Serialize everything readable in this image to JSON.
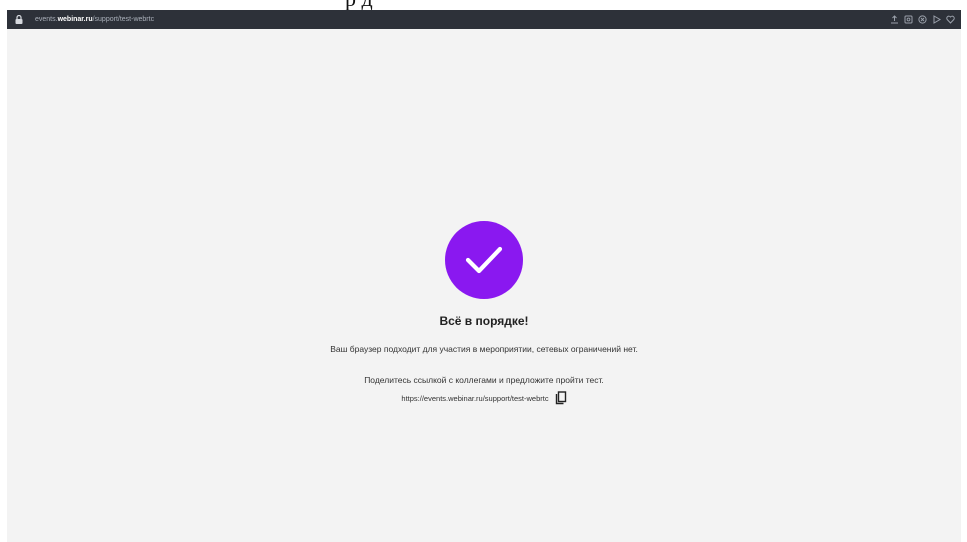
{
  "top_crop": {
    "text": "р д"
  },
  "address_bar": {
    "url_prefix": "events.",
    "url_host": "webinar.ru",
    "url_path": "/support/test-webrtc",
    "icons": [
      "share-icon",
      "screenshot-icon",
      "close-circle-icon",
      "play-icon",
      "heart-icon"
    ]
  },
  "main": {
    "title": "Всё в порядке!",
    "description": "Ваш браузер подходит для участия в мероприятии, сетевых ограничений нет.",
    "share_prompt": "Поделитесь ссылкой с коллегами и предложите пройти тест.",
    "link": "https://events.webinar.ru/support/test-webrtc"
  },
  "colors": {
    "accent": "#8a18f0",
    "address_bar_bg": "#2d3139",
    "page_bg": "#f3f3f3"
  }
}
